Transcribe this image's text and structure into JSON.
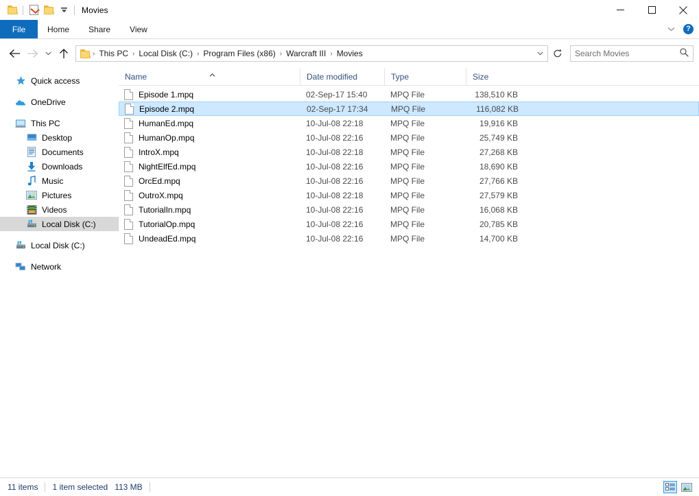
{
  "window": {
    "title": "Movies",
    "quick_access_toolbar": [
      {
        "name": "folder-properties-icon",
        "label": "Properties"
      },
      {
        "name": "new-folder-icon",
        "label": "New folder"
      },
      {
        "name": "customize-qat-icon",
        "label": "Customize Quick Access Toolbar"
      }
    ],
    "controls": {
      "minimize": "Minimize",
      "maximize": "Maximize",
      "close": "Close"
    }
  },
  "ribbon": {
    "tabs": [
      {
        "label": "File",
        "active": true
      },
      {
        "label": "Home",
        "active": false
      },
      {
        "label": "Share",
        "active": false
      },
      {
        "label": "View",
        "active": false
      }
    ],
    "collapse_label": "Minimize the Ribbon",
    "help_label": "?"
  },
  "address": {
    "back": "Back",
    "forward": "Forward",
    "recent": "Recent locations",
    "up": "Up",
    "breadcrumbs": [
      "This PC",
      "Local Disk (C:)",
      "Program Files (x86)",
      "Warcraft III",
      "Movies"
    ],
    "separator": "›",
    "refresh": "Refresh",
    "dropdown": "Previous locations"
  },
  "search": {
    "placeholder": "Search Movies",
    "icon": "search-icon"
  },
  "sidebar": {
    "items": [
      {
        "label": "Quick access",
        "icon": "star-icon",
        "indent": false,
        "selected": false,
        "gap_after": true
      },
      {
        "label": "OneDrive",
        "icon": "cloud-icon",
        "indent": false,
        "selected": false,
        "gap_after": true
      },
      {
        "label": "This PC",
        "icon": "monitor-icon",
        "indent": false,
        "selected": false,
        "gap_after": false
      },
      {
        "label": "Desktop",
        "icon": "desktop-icon",
        "indent": true,
        "selected": false,
        "gap_after": false
      },
      {
        "label": "Documents",
        "icon": "documents-icon",
        "indent": true,
        "selected": false,
        "gap_after": false
      },
      {
        "label": "Downloads",
        "icon": "downloads-icon",
        "indent": true,
        "selected": false,
        "gap_after": false
      },
      {
        "label": "Music",
        "icon": "music-icon",
        "indent": true,
        "selected": false,
        "gap_after": false
      },
      {
        "label": "Pictures",
        "icon": "pictures-icon",
        "indent": true,
        "selected": false,
        "gap_after": false
      },
      {
        "label": "Videos",
        "icon": "videos-icon",
        "indent": true,
        "selected": false,
        "gap_after": false
      },
      {
        "label": "Local Disk (C:)",
        "icon": "drive-icon",
        "indent": true,
        "selected": true,
        "gap_after": true
      },
      {
        "label": "Local Disk (C:)",
        "icon": "drive-icon",
        "indent": false,
        "selected": false,
        "gap_after": true
      },
      {
        "label": "Network",
        "icon": "network-icon",
        "indent": false,
        "selected": false,
        "gap_after": false
      }
    ]
  },
  "filelist": {
    "columns": [
      {
        "label": "Name",
        "sorted": "asc"
      },
      {
        "label": "Date modified",
        "sorted": null
      },
      {
        "label": "Type",
        "sorted": null
      },
      {
        "label": "Size",
        "sorted": null
      }
    ],
    "rows": [
      {
        "name": "Episode 1.mpq",
        "date": "02-Sep-17 15:40",
        "type": "MPQ File",
        "size": "138,510 KB",
        "selected": false
      },
      {
        "name": "Episode 2.mpq",
        "date": "02-Sep-17 17:34",
        "type": "MPQ File",
        "size": "116,082 KB",
        "selected": true
      },
      {
        "name": "HumanEd.mpq",
        "date": "10-Jul-08 22:18",
        "type": "MPQ File",
        "size": "19,916 KB",
        "selected": false
      },
      {
        "name": "HumanOp.mpq",
        "date": "10-Jul-08 22:16",
        "type": "MPQ File",
        "size": "25,749 KB",
        "selected": false
      },
      {
        "name": "IntroX.mpq",
        "date": "10-Jul-08 22:18",
        "type": "MPQ File",
        "size": "27,268 KB",
        "selected": false
      },
      {
        "name": "NightElfEd.mpq",
        "date": "10-Jul-08 22:16",
        "type": "MPQ File",
        "size": "18,690 KB",
        "selected": false
      },
      {
        "name": "OrcEd.mpq",
        "date": "10-Jul-08 22:16",
        "type": "MPQ File",
        "size": "27,766 KB",
        "selected": false
      },
      {
        "name": "OutroX.mpq",
        "date": "10-Jul-08 22:18",
        "type": "MPQ File",
        "size": "27,579 KB",
        "selected": false
      },
      {
        "name": "TutorialIn.mpq",
        "date": "10-Jul-08 22:16",
        "type": "MPQ File",
        "size": "16,068 KB",
        "selected": false
      },
      {
        "name": "TutorialOp.mpq",
        "date": "10-Jul-08 22:16",
        "type": "MPQ File",
        "size": "20,785 KB",
        "selected": false
      },
      {
        "name": "UndeadEd.mpq",
        "date": "10-Jul-08 22:16",
        "type": "MPQ File",
        "size": "14,700 KB",
        "selected": false
      }
    ]
  },
  "statusbar": {
    "item_count": "11 items",
    "selection": "1 item selected",
    "selection_size": "113 MB",
    "views": [
      {
        "name": "details-view-button",
        "label": "Details view",
        "active": true
      },
      {
        "name": "large-icons-view-button",
        "label": "Large icons view",
        "active": false
      }
    ]
  },
  "colors": {
    "accent": "#0f6cbd",
    "selection": "#cde8ff",
    "selection_border": "#99d1ff",
    "nav_selected": "#d8d8d8",
    "header_text": "#33507d",
    "status_text": "#1b3a6b"
  }
}
